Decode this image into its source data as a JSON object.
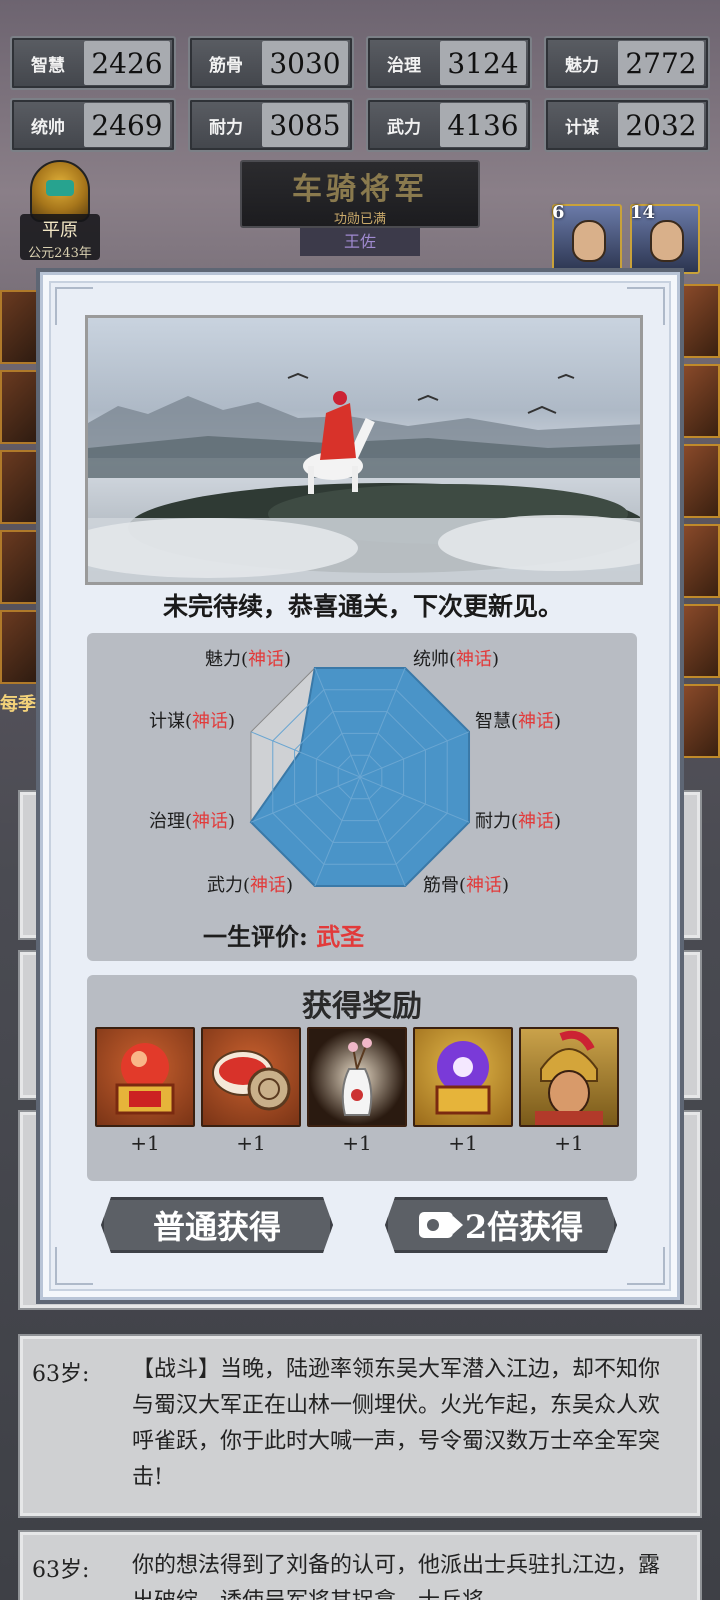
{
  "stats": [
    {
      "label": "智慧",
      "value": "2426"
    },
    {
      "label": "筋骨",
      "value": "3030"
    },
    {
      "label": "治理",
      "value": "3124"
    },
    {
      "label": "魅力",
      "value": "2772"
    },
    {
      "label": "统帅",
      "value": "2469"
    },
    {
      "label": "耐力",
      "value": "3085"
    },
    {
      "label": "武力",
      "value": "4136"
    },
    {
      "label": "计谋",
      "value": "2032"
    }
  ],
  "location": {
    "place": "平原",
    "year": "公元243年"
  },
  "rank": {
    "title": "车骑将军",
    "subtitle": "功勋已满",
    "name": "王佐"
  },
  "portraits": [
    {
      "level": "6"
    },
    {
      "level": "14"
    }
  ],
  "left_banner_text": "每季",
  "modal": {
    "headline": "未完待续，恭喜通关，下次更新见。",
    "radar": {
      "axes": [
        {
          "name": "魅力",
          "grade": "神话"
        },
        {
          "name": "统帅",
          "grade": "神话"
        },
        {
          "name": "智慧",
          "grade": "神话"
        },
        {
          "name": "耐力",
          "grade": "神话"
        },
        {
          "name": "筋骨",
          "grade": "神话"
        },
        {
          "name": "武力",
          "grade": "神话"
        },
        {
          "name": "治理",
          "grade": "神话"
        },
        {
          "name": "计谋",
          "grade": "神话"
        }
      ],
      "levels": [
        1.0,
        1.0,
        1.0,
        1.0,
        1.0,
        1.0,
        1.0,
        0.55
      ],
      "rating_label": "一生评价:",
      "rating_value": "武圣"
    },
    "rewards": {
      "title": "获得奖励",
      "items": [
        {
          "icon": "red-orb-chest-icon",
          "count": "+1"
        },
        {
          "icon": "rouge-box-icon",
          "count": "+1"
        },
        {
          "icon": "plum-vase-icon",
          "count": "+1"
        },
        {
          "icon": "purple-orb-chest-icon",
          "count": "+1"
        },
        {
          "icon": "general-portrait-icon",
          "count": "+1"
        }
      ]
    },
    "buttons": {
      "normal": "普通获得",
      "double": "2倍获得"
    }
  },
  "logs": [
    {
      "age": "63岁:",
      "text": "【战斗】当晚，陆逊率领东吴大军潜入江边，却不知你与蜀汉大军正在山林一侧埋伏。火光乍起，东吴众人欢呼雀跃，你于此时大喊一声，号令蜀汉数万士卒全军突击!"
    },
    {
      "age": "63岁:",
      "text": "你的想法得到了刘备的认可，他派出士兵驻扎江边，露出破绽，诱使吴军将其捉拿，士兵将"
    }
  ],
  "colors": {
    "accent_red": "#e23a3a",
    "radar_fill": "#4a94c8",
    "panel": "#b8bcc3"
  }
}
